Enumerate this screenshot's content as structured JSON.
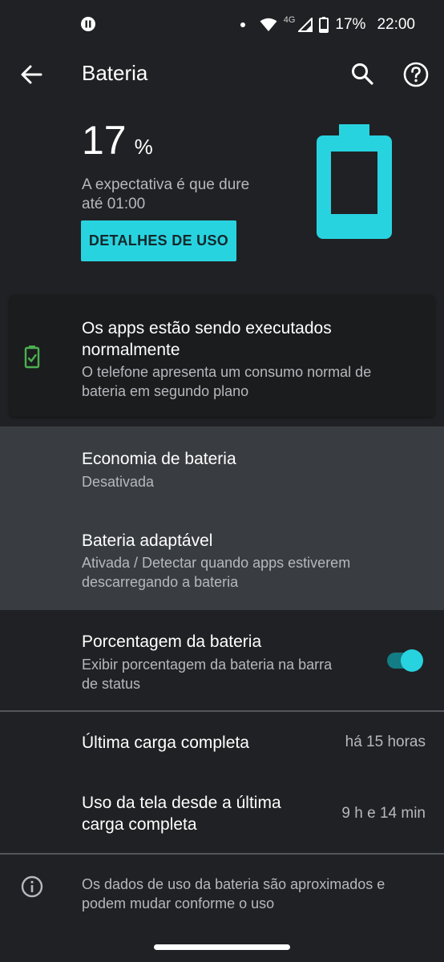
{
  "status_bar": {
    "network_label": "4G",
    "battery_percent": "17%",
    "time": "22:00"
  },
  "appbar": {
    "title": "Bateria"
  },
  "battery": {
    "level_value": "17",
    "level_unit": "%",
    "level_fraction": 0.17,
    "expectation": "A expectativa é que dure até 01:00",
    "usage_button": "DETALHES DE USO",
    "accent_color": "#28d3e0"
  },
  "apps_card": {
    "title": "Os apps estão sendo executados normalmente",
    "subtitle": "O telefone apresenta um consumo normal de bateria em segundo plano",
    "icon_color": "#4caf50"
  },
  "settings": {
    "battery_saver": {
      "title": "Economia de bateria",
      "subtitle": "Desativada"
    },
    "adaptive": {
      "title": "Bateria adaptável",
      "subtitle": "Ativada / Detectar quando apps estiverem descarregando a bateria"
    },
    "percentage": {
      "title": "Porcentagem da bateria",
      "subtitle": "Exibir porcentagem da bateria na barra de status",
      "enabled": true
    }
  },
  "stats": {
    "last_charge": {
      "label": "Última carga completa",
      "value": "há 15 horas"
    },
    "screen_usage": {
      "label": "Uso da tela desde a última carga completa",
      "value": "9 h e 14 min"
    }
  },
  "footer": {
    "text": "Os dados de uso da bateria são aproximados e podem mudar conforme o uso"
  }
}
